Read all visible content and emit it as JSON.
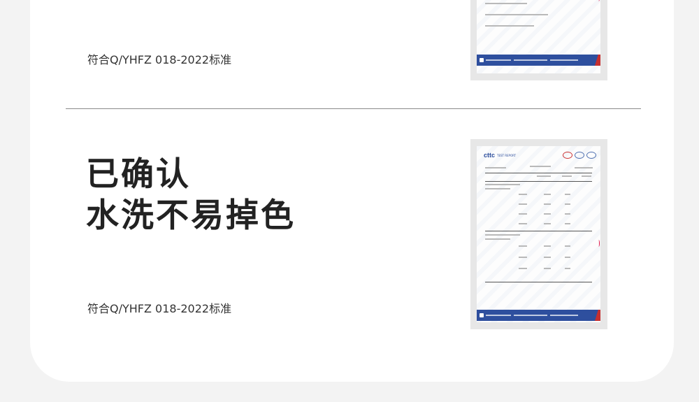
{
  "standard_note": "符合Q/YHFZ 018-2022标准",
  "headline": {
    "line1": "已确认",
    "line2": "水洗不易掉色"
  },
  "report": {
    "logo_text": "cttc",
    "logo_subtitle": "TEST REPORT"
  },
  "colors": {
    "card_bg": "#ffffff",
    "page_bg": "#f3f3f3",
    "footer_blue": "#2e4f9e",
    "accent_red": "#c62f2f"
  }
}
